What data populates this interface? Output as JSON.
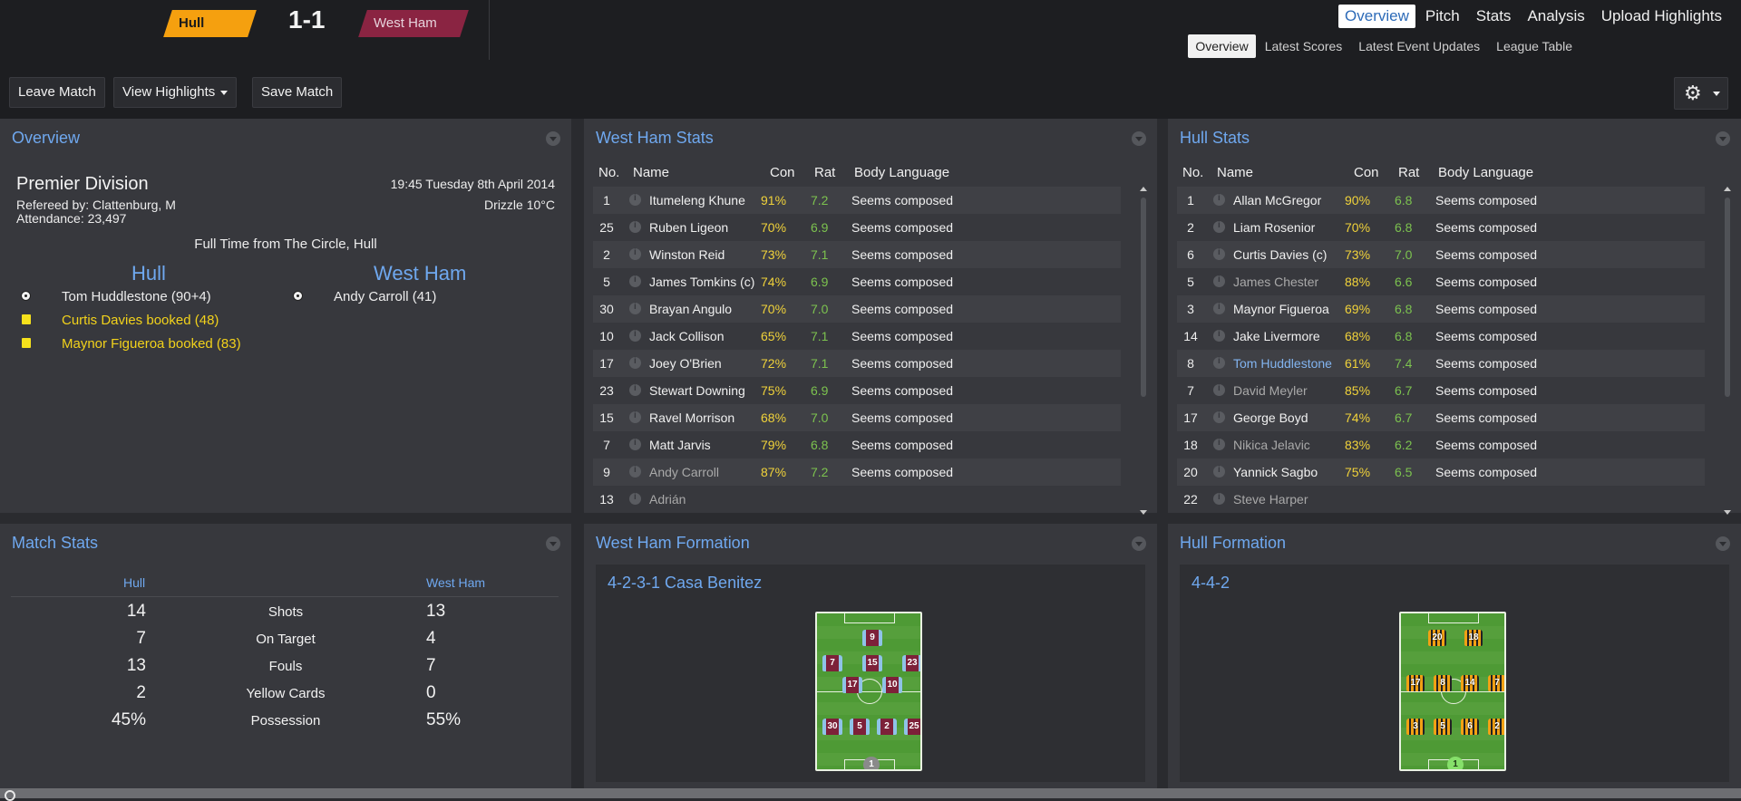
{
  "header": {
    "home_team": "Hull",
    "away_team": "West Ham",
    "score": "1-1",
    "home_color": "#f5a00f",
    "away_color": "#8a2442"
  },
  "nav": {
    "main": [
      "Overview",
      "Pitch",
      "Stats",
      "Analysis",
      "Upload Highlights"
    ],
    "main_active": "Overview",
    "sub": [
      "Overview",
      "Latest Scores",
      "Latest Event Updates",
      "League Table"
    ],
    "sub_active": "Overview"
  },
  "toolbar": {
    "leave": "Leave Match",
    "highlights": "View Highlights",
    "save": "Save Match",
    "settings_icon": "gear-icon"
  },
  "overview": {
    "title": "Overview",
    "competition": "Premier Division",
    "datetime": "19:45 Tuesday 8th April 2014",
    "referee": "Refereed by: Clattenburg, M",
    "weather": "Drizzle 10°C",
    "attendance": "Attendance: 23,497",
    "full_time": "Full Time from The Circle, Hull",
    "home_team": "Hull",
    "away_team": "West Ham",
    "home_goal": "Tom Huddlestone (90+4)",
    "away_goal": "Andy Carroll (41)",
    "home_card_1": "Curtis Davies booked (48)",
    "home_card_2": "Maynor Figueroa booked (83)"
  },
  "table_headers": {
    "no": "No.",
    "name": "Name",
    "con": "Con",
    "rat": "Rat",
    "body": "Body Language"
  },
  "west_ham_stats": {
    "title": "West Ham Stats",
    "rows": [
      {
        "no": "1",
        "name": "Itumeleng Khune",
        "con": "91%",
        "rat": "7.2",
        "body": "Seems composed",
        "style": ""
      },
      {
        "no": "25",
        "name": "Ruben Ligeon",
        "con": "70%",
        "rat": "6.9",
        "body": "Seems composed",
        "style": ""
      },
      {
        "no": "2",
        "name": "Winston Reid",
        "con": "73%",
        "rat": "7.1",
        "body": "Seems composed",
        "style": ""
      },
      {
        "no": "5",
        "name": "James Tomkins (c)",
        "con": "74%",
        "rat": "6.9",
        "body": "Seems composed",
        "style": ""
      },
      {
        "no": "30",
        "name": "Brayan Angulo",
        "con": "70%",
        "rat": "7.0",
        "body": "Seems composed",
        "style": ""
      },
      {
        "no": "10",
        "name": "Jack Collison",
        "con": "65%",
        "rat": "7.1",
        "body": "Seems composed",
        "style": ""
      },
      {
        "no": "17",
        "name": "Joey O'Brien",
        "con": "72%",
        "rat": "7.1",
        "body": "Seems composed",
        "style": ""
      },
      {
        "no": "23",
        "name": "Stewart Downing",
        "con": "75%",
        "rat": "6.9",
        "body": "Seems composed",
        "style": ""
      },
      {
        "no": "15",
        "name": "Ravel Morrison",
        "con": "68%",
        "rat": "7.0",
        "body": "Seems composed",
        "style": ""
      },
      {
        "no": "7",
        "name": "Matt Jarvis",
        "con": "79%",
        "rat": "6.8",
        "body": "Seems composed",
        "style": ""
      },
      {
        "no": "9",
        "name": "Andy Carroll",
        "con": "87%",
        "rat": "7.2",
        "body": "Seems composed",
        "style": "dim"
      },
      {
        "no": "13",
        "name": "Adrián",
        "con": "",
        "rat": "",
        "body": "",
        "style": "dim"
      }
    ]
  },
  "hull_stats": {
    "title": "Hull Stats",
    "rows": [
      {
        "no": "1",
        "name": "Allan McGregor",
        "con": "90%",
        "rat": "6.8",
        "body": "Seems composed",
        "style": ""
      },
      {
        "no": "2",
        "name": "Liam Rosenior",
        "con": "70%",
        "rat": "6.8",
        "body": "Seems composed",
        "style": ""
      },
      {
        "no": "6",
        "name": "Curtis Davies (c)",
        "con": "73%",
        "rat": "7.0",
        "body": "Seems composed",
        "style": ""
      },
      {
        "no": "5",
        "name": "James Chester",
        "con": "88%",
        "rat": "6.6",
        "body": "Seems composed",
        "style": "dim"
      },
      {
        "no": "3",
        "name": "Maynor Figueroa",
        "con": "69%",
        "rat": "6.8",
        "body": "Seems composed",
        "style": ""
      },
      {
        "no": "14",
        "name": "Jake Livermore",
        "con": "68%",
        "rat": "6.8",
        "body": "Seems composed",
        "style": ""
      },
      {
        "no": "8",
        "name": "Tom Huddlestone",
        "con": "61%",
        "rat": "7.4",
        "body": "Seems composed",
        "style": "link"
      },
      {
        "no": "7",
        "name": "David Meyler",
        "con": "85%",
        "rat": "6.7",
        "body": "Seems composed",
        "style": "dim"
      },
      {
        "no": "17",
        "name": "George Boyd",
        "con": "74%",
        "rat": "6.7",
        "body": "Seems composed",
        "style": ""
      },
      {
        "no": "18",
        "name": "Nikica Jelavic",
        "con": "83%",
        "rat": "6.2",
        "body": "Seems composed",
        "style": "dim"
      },
      {
        "no": "20",
        "name": "Yannick Sagbo",
        "con": "75%",
        "rat": "6.5",
        "body": "Seems composed",
        "style": ""
      },
      {
        "no": "22",
        "name": "Steve Harper",
        "con": "",
        "rat": "",
        "body": "",
        "style": "dim"
      }
    ]
  },
  "match_stats": {
    "title": "Match Stats",
    "home": "Hull",
    "away": "West Ham",
    "rows": [
      {
        "label": "Shots",
        "home": "14",
        "away": "13"
      },
      {
        "label": "On Target",
        "home": "7",
        "away": "4"
      },
      {
        "label": "Fouls",
        "home": "13",
        "away": "7"
      },
      {
        "label": "Yellow Cards",
        "home": "2",
        "away": "0"
      },
      {
        "label": "Possession",
        "home": "45%",
        "away": "55%"
      }
    ]
  },
  "west_ham_formation": {
    "title": "West Ham Formation",
    "name": "4-2-3-1 Casa Benitez",
    "players": [
      "9",
      "7",
      "15",
      "23",
      "17",
      "10",
      "30",
      "5",
      "2",
      "25",
      "1"
    ]
  },
  "hull_formation": {
    "title": "Hull Formation",
    "name": "4-4-2",
    "players": [
      "20",
      "18",
      "17",
      "8",
      "14",
      "7",
      "3",
      "5",
      "6",
      "2",
      "1"
    ]
  }
}
